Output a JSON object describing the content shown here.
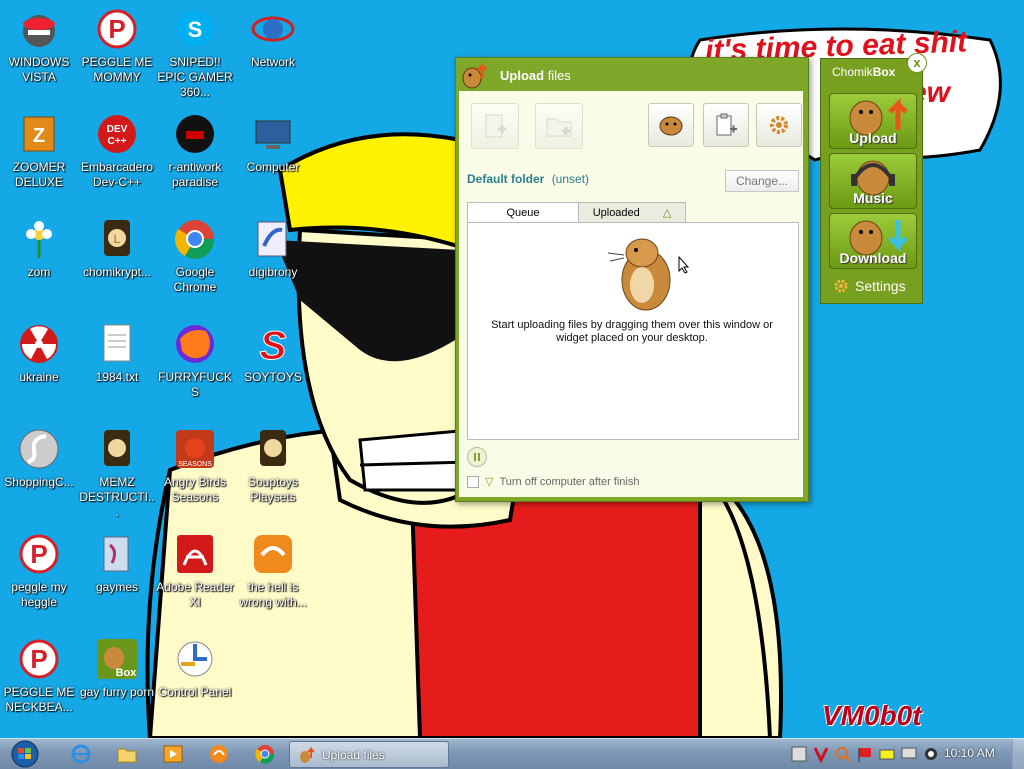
{
  "wallpaper": {
    "speech_line1": "it's time to eat shit",
    "speech_line2": "ew",
    "watermark": "VM0b0t"
  },
  "desktop_icons": [
    {
      "label": "WINDOWS VISTA",
      "icon": "vista-orb-icon"
    },
    {
      "label": "PEGGLE ME MOMMY",
      "icon": "peggle-icon"
    },
    {
      "label": "SNIPED!! EPIC GAMER 360...",
      "icon": "skype-icon"
    },
    {
      "label": "Network",
      "icon": "network-icon"
    },
    {
      "label": "ZOOMER DELUXE",
      "icon": "zuma-icon"
    },
    {
      "label": "Embarcadero Dev-C++",
      "icon": "devcpp-icon"
    },
    {
      "label": "r-antiwork paradise",
      "icon": "antiwork-icon"
    },
    {
      "label": "Computer",
      "icon": "computer-icon"
    },
    {
      "label": "zom",
      "icon": "flower-icon"
    },
    {
      "label": "chomikrypt...",
      "icon": "chomik-shortcut-icon"
    },
    {
      "label": "Google Chrome",
      "icon": "chrome-icon"
    },
    {
      "label": "digibrony",
      "icon": "digibrony-icon"
    },
    {
      "label": "ukraine",
      "icon": "radiation-icon"
    },
    {
      "label": "1984.txt",
      "icon": "text-file-icon"
    },
    {
      "label": "FURRYFUCKS",
      "icon": "firefox-icon"
    },
    {
      "label": "SOYTOYS",
      "icon": "soytoys-icon"
    },
    {
      "label": "ShoppingC...",
      "icon": "flash-icon"
    },
    {
      "label": "MEMZ DESTRUCTI...",
      "icon": "memz-icon"
    },
    {
      "label": "Angry Birds Seasons",
      "icon": "angry-birds-icon"
    },
    {
      "label": "Souptoys Playsets",
      "icon": "souptoys-icon"
    },
    {
      "label": "peggle my heggle",
      "icon": "peggle-icon"
    },
    {
      "label": "gaymes",
      "icon": "games-folder-icon"
    },
    {
      "label": "Adobe Reader XI",
      "icon": "adobe-reader-icon"
    },
    {
      "label": "the hell is wrong with...",
      "icon": "uc-browser-icon"
    },
    {
      "label": "PEGGLE ME NECKBEA...",
      "icon": "peggle-icon"
    },
    {
      "label": "gay furry porn",
      "icon": "chomikbox-icon"
    },
    {
      "label": "Control Panel",
      "icon": "control-panel-icon"
    }
  ],
  "upload_window": {
    "title_prefix": "Upload",
    "title_suffix": "files",
    "default_folder_label": "Default folder",
    "default_folder_value": "(unset)",
    "change_button": "Change...",
    "tabs": [
      "Queue",
      "Uploaded"
    ],
    "hint": "Start uploading files by dragging them over this window or widget placed on your desktop.",
    "turn_off_label": "Turn off computer after finish"
  },
  "chomikbox_widget": {
    "title_a": "Chomik",
    "title_b": "Box",
    "close": "x",
    "buttons": [
      "Upload",
      "Music",
      "Download"
    ],
    "settings": "Settings"
  },
  "taskbar": {
    "active_item": "Upload files",
    "clock": "10:10 AM"
  },
  "colors": {
    "desktop_bg": "#14a8e6",
    "window_green": "#7fa82a",
    "panel_cream": "#fbfce8"
  }
}
